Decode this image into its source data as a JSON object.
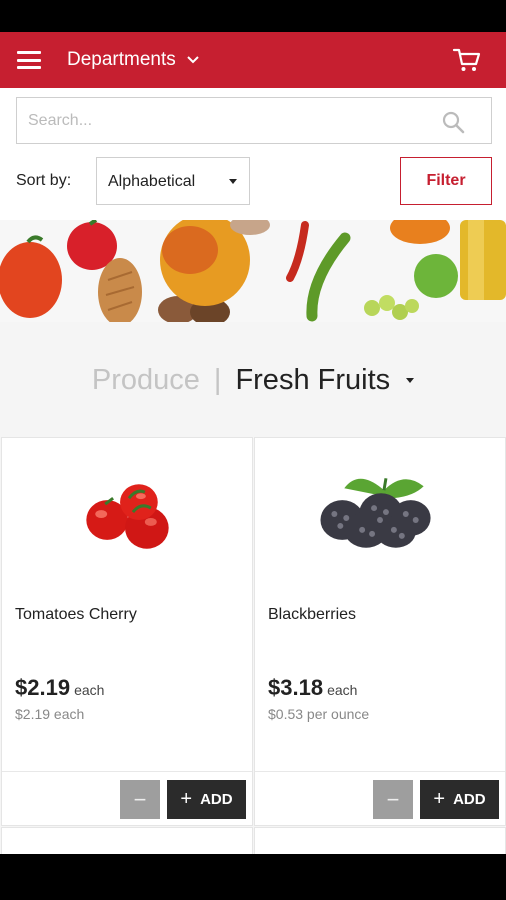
{
  "header": {
    "departments_label": "Departments"
  },
  "search": {
    "placeholder": "Search..."
  },
  "sort": {
    "label": "Sort by:",
    "selected": "Alphabetical"
  },
  "filter_label": "Filter",
  "breadcrumb": {
    "parent": "Produce",
    "separator": "|",
    "current": "Fresh Fruits"
  },
  "products": [
    {
      "name": "Tomatoes Cherry",
      "price": "$2.19",
      "price_unit": "each",
      "unit_price": "$2.19 each",
      "minus_label": "−",
      "add_label": "ADD"
    },
    {
      "name": "Blackberries",
      "price": "$3.18",
      "price_unit": "each",
      "unit_price": "$0.53 per ounce",
      "minus_label": "−",
      "add_label": "ADD"
    }
  ],
  "colors": {
    "brand": "#c61f30",
    "add_button": "#2b2b2b",
    "minus_button": "#9e9e9e"
  },
  "icons": [
    "menu-icon",
    "chevron-down-icon",
    "cart-icon",
    "search-icon",
    "plus-icon"
  ]
}
